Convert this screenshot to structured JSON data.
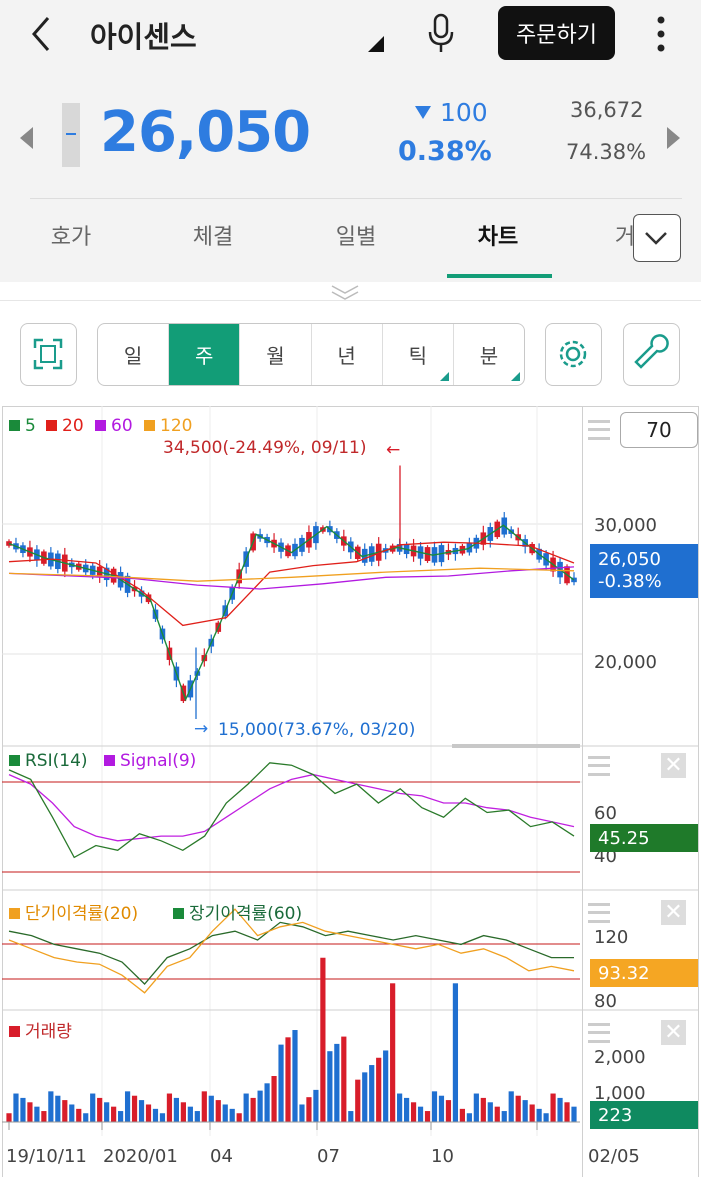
{
  "header": {
    "title": "아이센스",
    "order_label": "주문하기"
  },
  "quote": {
    "price": "26,050",
    "change": "100",
    "change_pct": "0.38%",
    "volume": "36,672",
    "ratio": "74.38%",
    "color": "#2e7ce0"
  },
  "tabs": [
    {
      "label": "호가"
    },
    {
      "label": "체결"
    },
    {
      "label": "일별"
    },
    {
      "label": "차트"
    },
    {
      "label": "거"
    }
  ],
  "periods": [
    {
      "label": "일"
    },
    {
      "label": "주"
    },
    {
      "label": "월"
    },
    {
      "label": "년"
    },
    {
      "label": "틱"
    },
    {
      "label": "분"
    }
  ],
  "candle_count": "70",
  "main_chart": {
    "legend": [
      {
        "label": "5",
        "color": "#1a8a3a"
      },
      {
        "label": "20",
        "color": "#e0201a"
      },
      {
        "label": "60",
        "color": "#b21ae0"
      },
      {
        "label": "120",
        "color": "#f0a020"
      }
    ],
    "high_note": "34,500(-24.49%, 09/11)",
    "low_note": "15,000(73.67%, 03/20)",
    "yticks": [
      "30,000",
      "20,000"
    ],
    "price_tag": "26,050",
    "pct_tag": "-0.38%"
  },
  "rsi_panel": {
    "rsi_label": "RSI(14)",
    "signal_label": "Signal(9)",
    "yticks": [
      "60",
      "40"
    ],
    "value": "45.25"
  },
  "disp_panel": {
    "short_label": "단기이격률(20)",
    "long_label": "장기이격률(60)",
    "yticks": [
      "120",
      "80"
    ],
    "value": "93.32"
  },
  "vol_panel": {
    "label": "거래량",
    "yticks": [
      "2,000",
      "1,000"
    ],
    "value": "223"
  },
  "xaxis": [
    "19/10/11",
    "2020/01",
    "04",
    "07",
    "10",
    "02/05"
  ],
  "colors": {
    "up": "#d81d2a",
    "down": "#1f6fd0",
    "accent": "#129d77"
  },
  "chart_data": {
    "type": "candlestick",
    "title": "",
    "x": [
      "19/10/11",
      "2020/01",
      "04",
      "07",
      "10",
      "02/05"
    ],
    "series": [
      {
        "name": "5",
        "values": [
          28500,
          27400,
          26700,
          26000,
          24200,
          16500,
          22500,
          29200,
          27800,
          29800,
          27500,
          28200,
          27600,
          28100,
          29900,
          27700,
          25700
        ]
      },
      {
        "name": "20",
        "values": [
          27100,
          27300,
          27000,
          25000,
          22200,
          22800,
          26300,
          26800,
          27100,
          28400,
          28600,
          28500,
          28300,
          27000
        ]
      },
      {
        "name": "60",
        "values": [
          26200,
          26000,
          25800,
          25300,
          25000,
          25400,
          25900,
          26000,
          26400,
          26700
        ]
      },
      {
        "name": "120",
        "values": [
          26200,
          26000,
          25600,
          25900,
          26300,
          26600,
          26400
        ]
      }
    ],
    "ylim": [
      14000,
      34500
    ],
    "annotations": [
      "34,500(-24.49%, 09/11)",
      "15,000(73.67%, 03/20)"
    ]
  }
}
